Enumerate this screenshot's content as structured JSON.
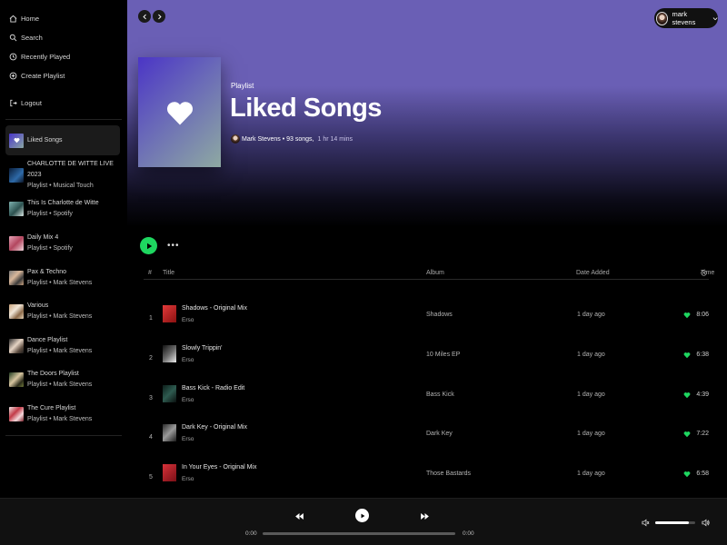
{
  "sidebar": {
    "nav": [
      {
        "label": "Home",
        "icon": "home-icon"
      },
      {
        "label": "Search",
        "icon": "search-icon"
      },
      {
        "label": "Recently Played",
        "icon": "history-icon"
      },
      {
        "label": "Create Playlist",
        "icon": "add-circle-icon"
      }
    ],
    "logout": {
      "label": "Logout",
      "icon": "logout-icon"
    },
    "playlists": [
      {
        "title": "Liked Songs",
        "subtitle": ""
      },
      {
        "title": "CHARLOTTE DE WITTE LIVE 2023",
        "subtitle": "Playlist • Musical Touch"
      },
      {
        "title": "This Is Charlotte de Witte",
        "subtitle": "Playlist • Spotify"
      },
      {
        "title": "Daily Mix 4",
        "subtitle": "Playlist • Spotify"
      },
      {
        "title": "Pax & Techno",
        "subtitle": "Playlist • Mark Stevens"
      },
      {
        "title": "Various",
        "subtitle": "Playlist • Mark Stevens"
      },
      {
        "title": "Dance Playlist",
        "subtitle": "Playlist • Mark Stevens"
      },
      {
        "title": "The Doors Playlist",
        "subtitle": "Playlist • Mark Stevens"
      },
      {
        "title": "The Cure Playlist",
        "subtitle": "Playlist • Mark Stevens"
      }
    ]
  },
  "header": {
    "user_name": "mark stevens",
    "back_icon": "chevron-left-icon",
    "forward_icon": "chevron-right-icon"
  },
  "playlist": {
    "type": "Playlist",
    "title": "Liked Songs",
    "owner_songs": "Mark Stevens • 93 songs,",
    "duration": "1 hr 14 mins",
    "hero_color": "#6a5fb5"
  },
  "table": {
    "headers": {
      "num": "#",
      "title": "Title",
      "album": "Album",
      "date_added": "Date Added",
      "time": "Time"
    },
    "rows": [
      {
        "num": "1",
        "title": "Shadows - Original Mix",
        "artist": "Erso",
        "album": "Shadows",
        "added": "1 day ago",
        "time": "8:06"
      },
      {
        "num": "2",
        "title": "Slowly Trippin'",
        "artist": "Erso",
        "album": "10 Miles EP",
        "added": "1 day ago",
        "time": "6:38"
      },
      {
        "num": "3",
        "title": "Bass Kick - Radio Edit",
        "artist": "Erso",
        "album": "Bass Kick",
        "added": "1 day ago",
        "time": "4:39"
      },
      {
        "num": "4",
        "title": "Dark Key - Original Mix",
        "artist": "Erso",
        "album": "Dark Key",
        "added": "1 day ago",
        "time": "7:22"
      },
      {
        "num": "5",
        "title": "In Your Eyes - Original Mix",
        "artist": "Erso",
        "album": "Those Bastards",
        "added": "1 day ago",
        "time": "6:58"
      }
    ]
  },
  "player": {
    "current_time": "0:00",
    "total_time": "0:00",
    "progress": 0,
    "volume": 0.85
  },
  "colors": {
    "accent": "#1ed760",
    "background": "#000000",
    "player_bg": "#111111"
  }
}
